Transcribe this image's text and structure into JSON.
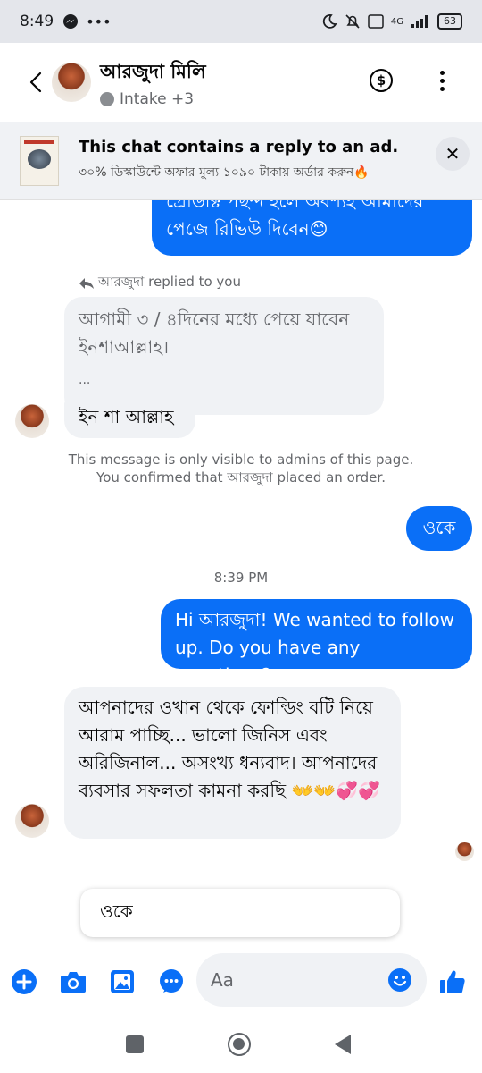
{
  "status_bar": {
    "time": "8:49",
    "battery": "63",
    "network": "4G"
  },
  "header": {
    "title": "আরজুদা মিলি",
    "subtitle": "Intake +3"
  },
  "ad_banner": {
    "title": "This chat contains a reply to an ad.",
    "subtitle": "৩০% ডিস্কাউন্টে অফার মুল্য ১০৯০ টাকায় অর্ডার করুন🔥"
  },
  "messages": {
    "out_top": "প্রোডাক্ট পছন্দ হলে অবশ্যই আমাদের পেজে রিভিউ দিবেন😊",
    "reply_label": "আরজুদা replied to you",
    "quoted": "আগামী ৩ / ৪দিনের মধ্যে পেয়ে যাবেন ইনশাআল্লাহ।",
    "quoted_ellipsis": "...",
    "in_reply": "ইন শা আল্লাহ",
    "admin_note_1": "This message is only visible to admins of this page.",
    "admin_note_2": "You confirmed that আরজুদা placed an order.",
    "out_ok": "ওকে",
    "timestamp": "8:39 PM",
    "out_followup": "Hi আরজুদা! We wanted to follow up. Do you have any questions?",
    "in_long": "আপনাদের ওখান থেকে ফোল্ডিং বটি নিয়ে আরাম পাচ্ছি... ভালো জিনিস এবং অরিজিনাল...  অসংখ্য ধন্যবাদ। আপনাদের ব্যবসার সফলতা কামনা করছি 👐👐💞💞"
  },
  "quick_reply": "ওকে",
  "composer": {
    "placeholder": "Aa"
  },
  "colors": {
    "accent": "#0a6ff7",
    "bubble_in": "#f0f2f5",
    "banner": "#f0f2f5"
  }
}
